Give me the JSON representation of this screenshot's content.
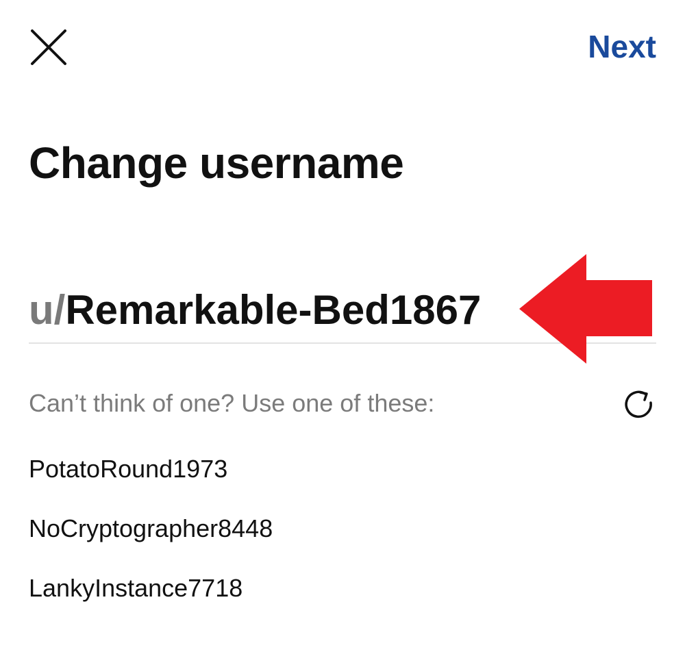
{
  "header": {
    "close_icon": "close-icon",
    "next_label": "Next",
    "next_color": "#1a4a9c"
  },
  "page": {
    "title": "Change username"
  },
  "username": {
    "prefix": "u/",
    "value": "Remarkable-Bed1867"
  },
  "annotation": {
    "arrow_icon": "left-arrow-icon",
    "arrow_color": "#ec1c24"
  },
  "suggestions": {
    "hint": "Can’t think of one? Use one of these:",
    "refresh_icon": "refresh-icon",
    "items": [
      "PotatoRound1973",
      "NoCryptographer8448",
      "LankyInstance7718"
    ]
  }
}
